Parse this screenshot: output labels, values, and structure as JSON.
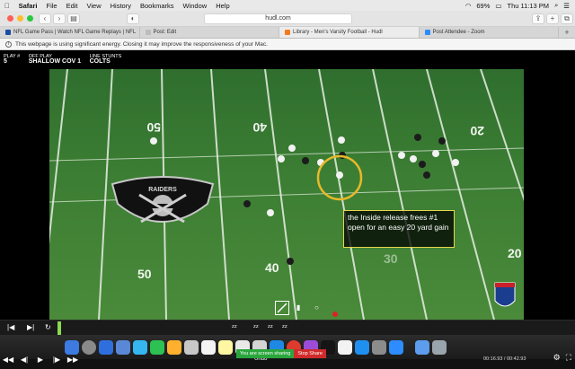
{
  "menubar": {
    "apple": "",
    "items": [
      "Safari",
      "File",
      "Edit",
      "View",
      "History",
      "Bookmarks",
      "Window",
      "Help"
    ],
    "battery": "69%",
    "clock": "Thu 11:13 PM"
  },
  "browser": {
    "url": "hudl.com",
    "back": "‹",
    "forward": "›"
  },
  "tabs": [
    {
      "label": "NFL Game Pass | Watch NFL Game Replays | NFL",
      "color": "#1a4ea3"
    },
    {
      "label": "Post: Edit",
      "color": "#bcbcbc"
    },
    {
      "label": "Library - Men's Varsity Football - Hudl",
      "color": "#f47a20"
    },
    {
      "label": "Post Attendee - Zoom",
      "color": "#2d8cff"
    }
  ],
  "notice": "This webpage is using significant energy. Closing it may improve the responsiveness of your Mac.",
  "player": {
    "play_label": "PLAY #",
    "play_value": "5",
    "off_play_label": "OFF PLAY",
    "off_play_value": "SHALLOW COV 1",
    "line_label": "LINE STUNTS",
    "line_value": "COLTS",
    "callout": "the Inside release frees #1 open for an easy 20 yard gain",
    "undo": "Undo",
    "timecode": "00:16.93 / 00:42.93",
    "field_numbers": [
      "50",
      "40",
      "20",
      "50",
      "40",
      "30",
      "20"
    ],
    "logo_text": "RAIDERS"
  },
  "share": {
    "sharing": "You are screen sharing",
    "stop": "Stop Share"
  },
  "colors": {
    "field": "#3b7d33",
    "callout_border": "#e6d64c",
    "circle": "#e8b92a"
  }
}
